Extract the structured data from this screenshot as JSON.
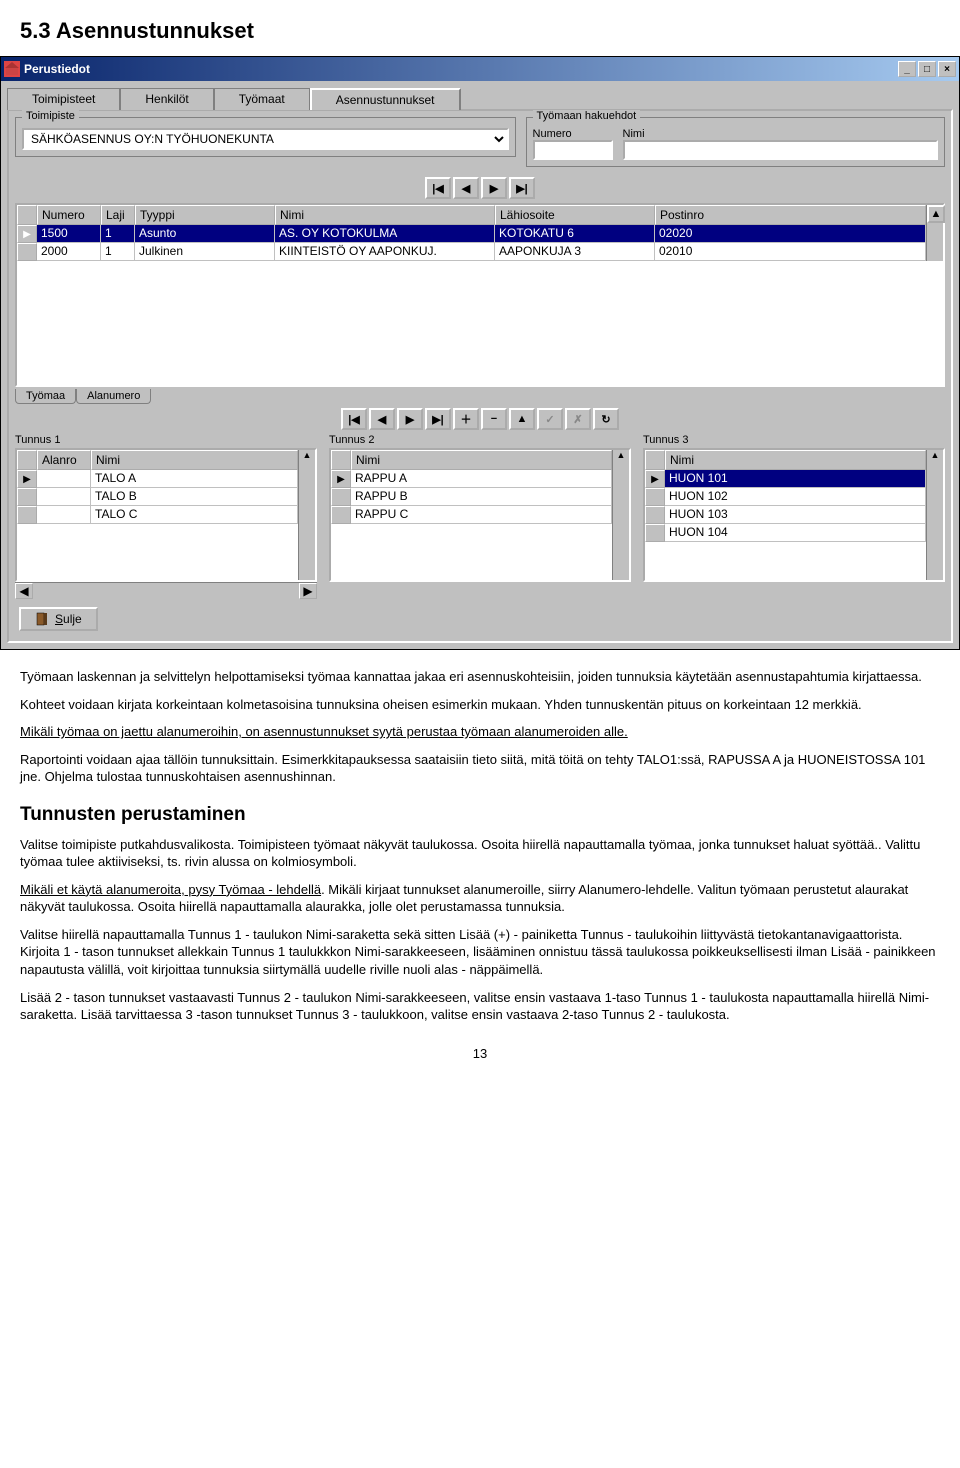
{
  "doc": {
    "heading": "5.3   Asennustunnukset",
    "p1": "Työmaan laskennan ja selvittelyn helpottamiseksi työmaa kannattaa jakaa eri asennuskohteisiin, joiden tunnuksia käytetään asennustapahtumia kirjattaessa.",
    "p2": "Kohteet voidaan kirjata korkeintaan kolmetasoisina tunnuksina oheisen esimerkin mukaan. Yhden tunnuskentän pituus on korkeintaan 12 merkkiä.",
    "p3": "Mikäli työmaa on jaettu alanumeroihin, on asennustunnukset syytä perustaa työmaan alanumeroiden alle.",
    "p4": "Raportointi voidaan ajaa tällöin tunnuksittain. Esimerkkitapauksessa saataisiin tieto siitä, mitä töitä on tehty TALO1:ssä, RAPUSSA A ja HUONEISTOSSA 101 jne. Ohjelma tulostaa tunnuskohtaisen asennushinnan.",
    "h3": "Tunnusten perustaminen",
    "p5": "Valitse toimipiste putkahdusvalikosta. Toimipisteen työmaat näkyvät taulukossa. Osoita hiirellä napauttamalla työmaa, jonka tunnukset haluat syöttää.. Valittu työmaa tulee aktiiviseksi, ts. rivin alussa on kolmiosymboli.",
    "p6a": "Mikäli et käytä alanumeroita, pysy Työmaa - lehdellä",
    "p6b": ". Mikäli kirjaat tunnukset alanumeroille, siirry Alanumero-lehdelle. Valitun työmaan perustetut alaurakat näkyvät taulukossa. Osoita hiirellä napauttamalla alaurakka, jolle olet perustamassa tunnuksia.",
    "p7": "Valitse hiirellä napauttamalla Tunnus 1 - taulukon Nimi-saraketta sekä sitten Lisää (+) - painiketta Tunnus - taulukoihin liittyvästä tietokantanavigaattorista. Kirjoita 1 - tason tunnukset allekkain Tunnus 1 taulukkkon Nimi-sarakkeeseen, lisääminen onnistuu tässä taulukossa poikkeuksellisesti ilman Lisää - painikkeen napautusta välillä, voit kirjoittaa tunnuksia siirtymällä uudelle riville nuoli alas - näppäimellä.",
    "p8": "Lisää 2 - tason tunnukset vastaavasti Tunnus 2 - taulukon Nimi-sarakkeeseen, valitse ensin vastaava 1-taso Tunnus 1 - taulukosta napauttamalla hiirellä Nimi-saraketta. Lisää tarvittaessa 3 -tason tunnukset Tunnus 3 - taulukkoon, valitse ensin vastaava 2-taso Tunnus 2 - taulukosta.",
    "pagenum": "13"
  },
  "window": {
    "title": "Perustiedot",
    "tabs": [
      "Toimipisteet",
      "Henkilöt",
      "Työmaat",
      "Asennustunnukset"
    ],
    "active_tab": 3,
    "toimipiste_label": "Toimipiste",
    "toimipiste_value": "SÄHKÖASENNUS OY:N TYÖHUONEKUNTA",
    "haku_group": "Työmaan hakuehdot",
    "haku_numero": "Numero",
    "haku_nimi": "Nimi",
    "grid_headers": [
      "Numero",
      "Laji",
      "Tyyppi",
      "Nimi",
      "Lähiosoite",
      "Postinro"
    ],
    "grid_rows": [
      {
        "numero": "1500",
        "laji": "1",
        "tyyppi": "Asunto",
        "nimi": "AS. OY KOTOKULMA",
        "lahi": "KOTOKATU 6",
        "post": "02020",
        "sel": true
      },
      {
        "numero": "2000",
        "laji": "1",
        "tyyppi": "Julkinen",
        "nimi": "KIINTEISTÖ OY AAPONKUJ.",
        "lahi": "AAPONKUJA 3",
        "post": "02010",
        "sel": false
      }
    ],
    "subtabs": [
      "Työmaa",
      "Alanumero"
    ],
    "tunnus1_label": "Tunnus 1",
    "tunnus2_label": "Tunnus 2",
    "tunnus3_label": "Tunnus 3",
    "tunnus1_headers": [
      "Alanro",
      "Nimi"
    ],
    "tunnus2_headers": [
      "Nimi"
    ],
    "tunnus3_headers": [
      "Nimi"
    ],
    "tunnus1_rows": [
      [
        "",
        "TALO A"
      ],
      [
        "",
        "TALO B"
      ],
      [
        "",
        "TALO C"
      ]
    ],
    "tunnus2_rows": [
      [
        "RAPPU A"
      ],
      [
        "RAPPU B"
      ],
      [
        "RAPPU C"
      ]
    ],
    "tunnus3_rows": [
      [
        "HUON 101"
      ],
      [
        "HUON 102"
      ],
      [
        "HUON 103"
      ],
      [
        "HUON 104"
      ]
    ],
    "tunnus3_selected": 0,
    "close_label": "Sulje"
  },
  "nav_icons": {
    "first": "|◀",
    "prev": "◀",
    "next": "▶",
    "last": "▶|",
    "plus": "＋",
    "minus": "−",
    "edit": "▲",
    "ok": "✓",
    "cancel": "✗",
    "refresh": "↻"
  }
}
